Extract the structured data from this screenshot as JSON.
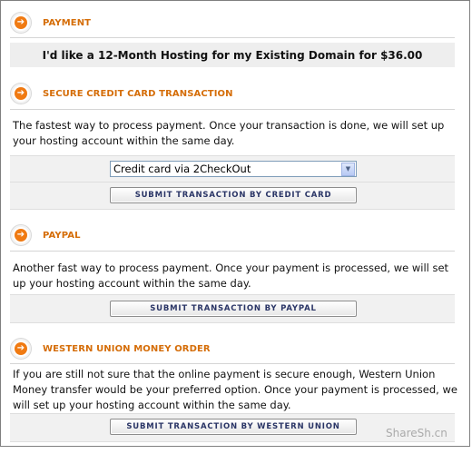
{
  "payment": {
    "title": "PAYMENT",
    "headline": "I'd like a 12-Month Hosting for my Existing Domain for $36.00"
  },
  "credit_card": {
    "title": "SECURE CREDIT CARD TRANSACTION",
    "description": "The fastest way to process payment. Once your transaction is done, we will set up your hosting account within the same day.",
    "select_value": "Credit card via 2CheckOut",
    "button_label": "SUBMIT TRANSACTION BY CREDIT CARD"
  },
  "paypal": {
    "title": "PAYPAL",
    "description": "Another fast way to process payment. Once your payment is processed, we will set up your hosting account within the same day.",
    "button_label": "SUBMIT TRANSACTION BY PAYPAL"
  },
  "western_union": {
    "title": "WESTERN UNION MONEY ORDER",
    "description": "If you are still not sure that the online payment is secure enough, Western Union Money transfer would be your preferred option. Once your payment is processed, we will set up your hosting account within the same day.",
    "button_label": "SUBMIT TRANSACTION BY WESTERN UNION"
  },
  "icons": {
    "section_icon": "arrow-right-circle-icon",
    "dropdown_icon": "chevron-down-icon"
  },
  "colors": {
    "accent": "#f07a12",
    "title": "#d56d08",
    "button_text": "#2a3566"
  },
  "watermark": "ShareSh.cn"
}
